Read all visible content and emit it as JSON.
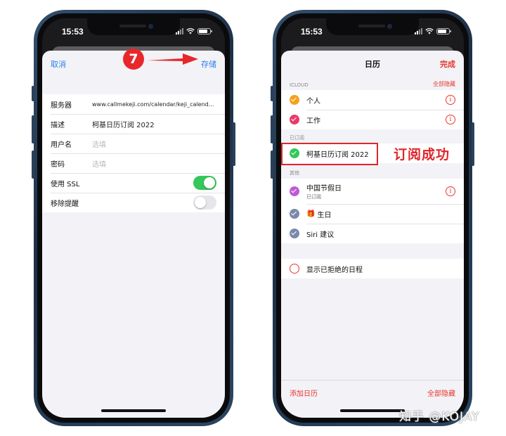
{
  "left_phone": {
    "status": {
      "time": "15:53"
    },
    "nav": {
      "cancel": "取消",
      "save": "存储"
    },
    "fields": [
      {
        "label": "服务器",
        "value": "www.callmekeji.com/calendar/keji_calend..."
      },
      {
        "label": "描述",
        "value": "柯基日历订阅 2022"
      },
      {
        "label": "用户名",
        "placeholder": "选填"
      },
      {
        "label": "密码",
        "placeholder": "选填"
      }
    ],
    "toggles": [
      {
        "label": "使用 SSL",
        "on": true
      },
      {
        "label": "移除提醒",
        "on": false
      }
    ]
  },
  "right_phone": {
    "status": {
      "time": "15:53"
    },
    "nav": {
      "title": "日历",
      "done": "完成"
    },
    "sections": {
      "icloud": {
        "header": "ICLOUD",
        "action": "全部隐藏",
        "items": [
          {
            "name": "个人",
            "color": "#f4a21d"
          },
          {
            "name": "工作",
            "color": "#e83a6b"
          }
        ]
      },
      "subscribed": {
        "header": "已订阅",
        "items": [
          {
            "name": "柯基日历订阅 2022",
            "color": "#34c759"
          }
        ]
      },
      "other": {
        "header": "其他",
        "items": [
          {
            "name": "中国节假日",
            "sub": "已订阅",
            "color": "#bf5ad6"
          },
          {
            "name": "生日",
            "color": "#7a8aa8"
          },
          {
            "name": "Siri 建议",
            "color": "#7a8aa8"
          }
        ]
      },
      "declined": {
        "label": "显示已拒绝的日程"
      }
    },
    "bottom": {
      "add": "添加日历",
      "hide_all": "全部隐藏"
    }
  },
  "annotations": {
    "step": "7",
    "success": "订阅成功",
    "watermark": "知乎 @KOJAY"
  },
  "colors": {
    "accent_red": "#e8382c",
    "link_blue": "#2f80e8",
    "toggle_green": "#34c759"
  }
}
